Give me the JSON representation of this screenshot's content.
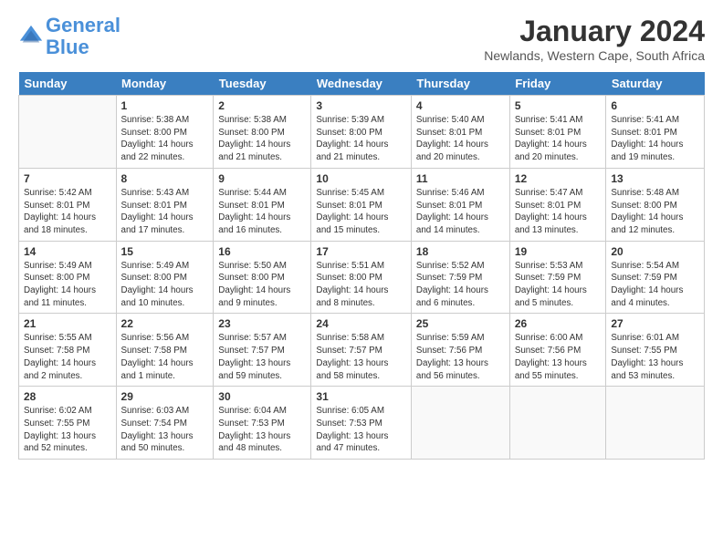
{
  "header": {
    "logo_line1": "General",
    "logo_line2": "Blue",
    "month": "January 2024",
    "location": "Newlands, Western Cape, South Africa"
  },
  "weekdays": [
    "Sunday",
    "Monday",
    "Tuesday",
    "Wednesday",
    "Thursday",
    "Friday",
    "Saturday"
  ],
  "weeks": [
    [
      {
        "day": "",
        "info": ""
      },
      {
        "day": "1",
        "info": "Sunrise: 5:38 AM\nSunset: 8:00 PM\nDaylight: 14 hours\nand 22 minutes."
      },
      {
        "day": "2",
        "info": "Sunrise: 5:38 AM\nSunset: 8:00 PM\nDaylight: 14 hours\nand 21 minutes."
      },
      {
        "day": "3",
        "info": "Sunrise: 5:39 AM\nSunset: 8:00 PM\nDaylight: 14 hours\nand 21 minutes."
      },
      {
        "day": "4",
        "info": "Sunrise: 5:40 AM\nSunset: 8:01 PM\nDaylight: 14 hours\nand 20 minutes."
      },
      {
        "day": "5",
        "info": "Sunrise: 5:41 AM\nSunset: 8:01 PM\nDaylight: 14 hours\nand 20 minutes."
      },
      {
        "day": "6",
        "info": "Sunrise: 5:41 AM\nSunset: 8:01 PM\nDaylight: 14 hours\nand 19 minutes."
      }
    ],
    [
      {
        "day": "7",
        "info": "Sunrise: 5:42 AM\nSunset: 8:01 PM\nDaylight: 14 hours\nand 18 minutes."
      },
      {
        "day": "8",
        "info": "Sunrise: 5:43 AM\nSunset: 8:01 PM\nDaylight: 14 hours\nand 17 minutes."
      },
      {
        "day": "9",
        "info": "Sunrise: 5:44 AM\nSunset: 8:01 PM\nDaylight: 14 hours\nand 16 minutes."
      },
      {
        "day": "10",
        "info": "Sunrise: 5:45 AM\nSunset: 8:01 PM\nDaylight: 14 hours\nand 15 minutes."
      },
      {
        "day": "11",
        "info": "Sunrise: 5:46 AM\nSunset: 8:01 PM\nDaylight: 14 hours\nand 14 minutes."
      },
      {
        "day": "12",
        "info": "Sunrise: 5:47 AM\nSunset: 8:01 PM\nDaylight: 14 hours\nand 13 minutes."
      },
      {
        "day": "13",
        "info": "Sunrise: 5:48 AM\nSunset: 8:00 PM\nDaylight: 14 hours\nand 12 minutes."
      }
    ],
    [
      {
        "day": "14",
        "info": "Sunrise: 5:49 AM\nSunset: 8:00 PM\nDaylight: 14 hours\nand 11 minutes."
      },
      {
        "day": "15",
        "info": "Sunrise: 5:49 AM\nSunset: 8:00 PM\nDaylight: 14 hours\nand 10 minutes."
      },
      {
        "day": "16",
        "info": "Sunrise: 5:50 AM\nSunset: 8:00 PM\nDaylight: 14 hours\nand 9 minutes."
      },
      {
        "day": "17",
        "info": "Sunrise: 5:51 AM\nSunset: 8:00 PM\nDaylight: 14 hours\nand 8 minutes."
      },
      {
        "day": "18",
        "info": "Sunrise: 5:52 AM\nSunset: 7:59 PM\nDaylight: 14 hours\nand 6 minutes."
      },
      {
        "day": "19",
        "info": "Sunrise: 5:53 AM\nSunset: 7:59 PM\nDaylight: 14 hours\nand 5 minutes."
      },
      {
        "day": "20",
        "info": "Sunrise: 5:54 AM\nSunset: 7:59 PM\nDaylight: 14 hours\nand 4 minutes."
      }
    ],
    [
      {
        "day": "21",
        "info": "Sunrise: 5:55 AM\nSunset: 7:58 PM\nDaylight: 14 hours\nand 2 minutes."
      },
      {
        "day": "22",
        "info": "Sunrise: 5:56 AM\nSunset: 7:58 PM\nDaylight: 14 hours\nand 1 minute."
      },
      {
        "day": "23",
        "info": "Sunrise: 5:57 AM\nSunset: 7:57 PM\nDaylight: 13 hours\nand 59 minutes."
      },
      {
        "day": "24",
        "info": "Sunrise: 5:58 AM\nSunset: 7:57 PM\nDaylight: 13 hours\nand 58 minutes."
      },
      {
        "day": "25",
        "info": "Sunrise: 5:59 AM\nSunset: 7:56 PM\nDaylight: 13 hours\nand 56 minutes."
      },
      {
        "day": "26",
        "info": "Sunrise: 6:00 AM\nSunset: 7:56 PM\nDaylight: 13 hours\nand 55 minutes."
      },
      {
        "day": "27",
        "info": "Sunrise: 6:01 AM\nSunset: 7:55 PM\nDaylight: 13 hours\nand 53 minutes."
      }
    ],
    [
      {
        "day": "28",
        "info": "Sunrise: 6:02 AM\nSunset: 7:55 PM\nDaylight: 13 hours\nand 52 minutes."
      },
      {
        "day": "29",
        "info": "Sunrise: 6:03 AM\nSunset: 7:54 PM\nDaylight: 13 hours\nand 50 minutes."
      },
      {
        "day": "30",
        "info": "Sunrise: 6:04 AM\nSunset: 7:53 PM\nDaylight: 13 hours\nand 48 minutes."
      },
      {
        "day": "31",
        "info": "Sunrise: 6:05 AM\nSunset: 7:53 PM\nDaylight: 13 hours\nand 47 minutes."
      },
      {
        "day": "",
        "info": ""
      },
      {
        "day": "",
        "info": ""
      },
      {
        "day": "",
        "info": ""
      }
    ]
  ]
}
